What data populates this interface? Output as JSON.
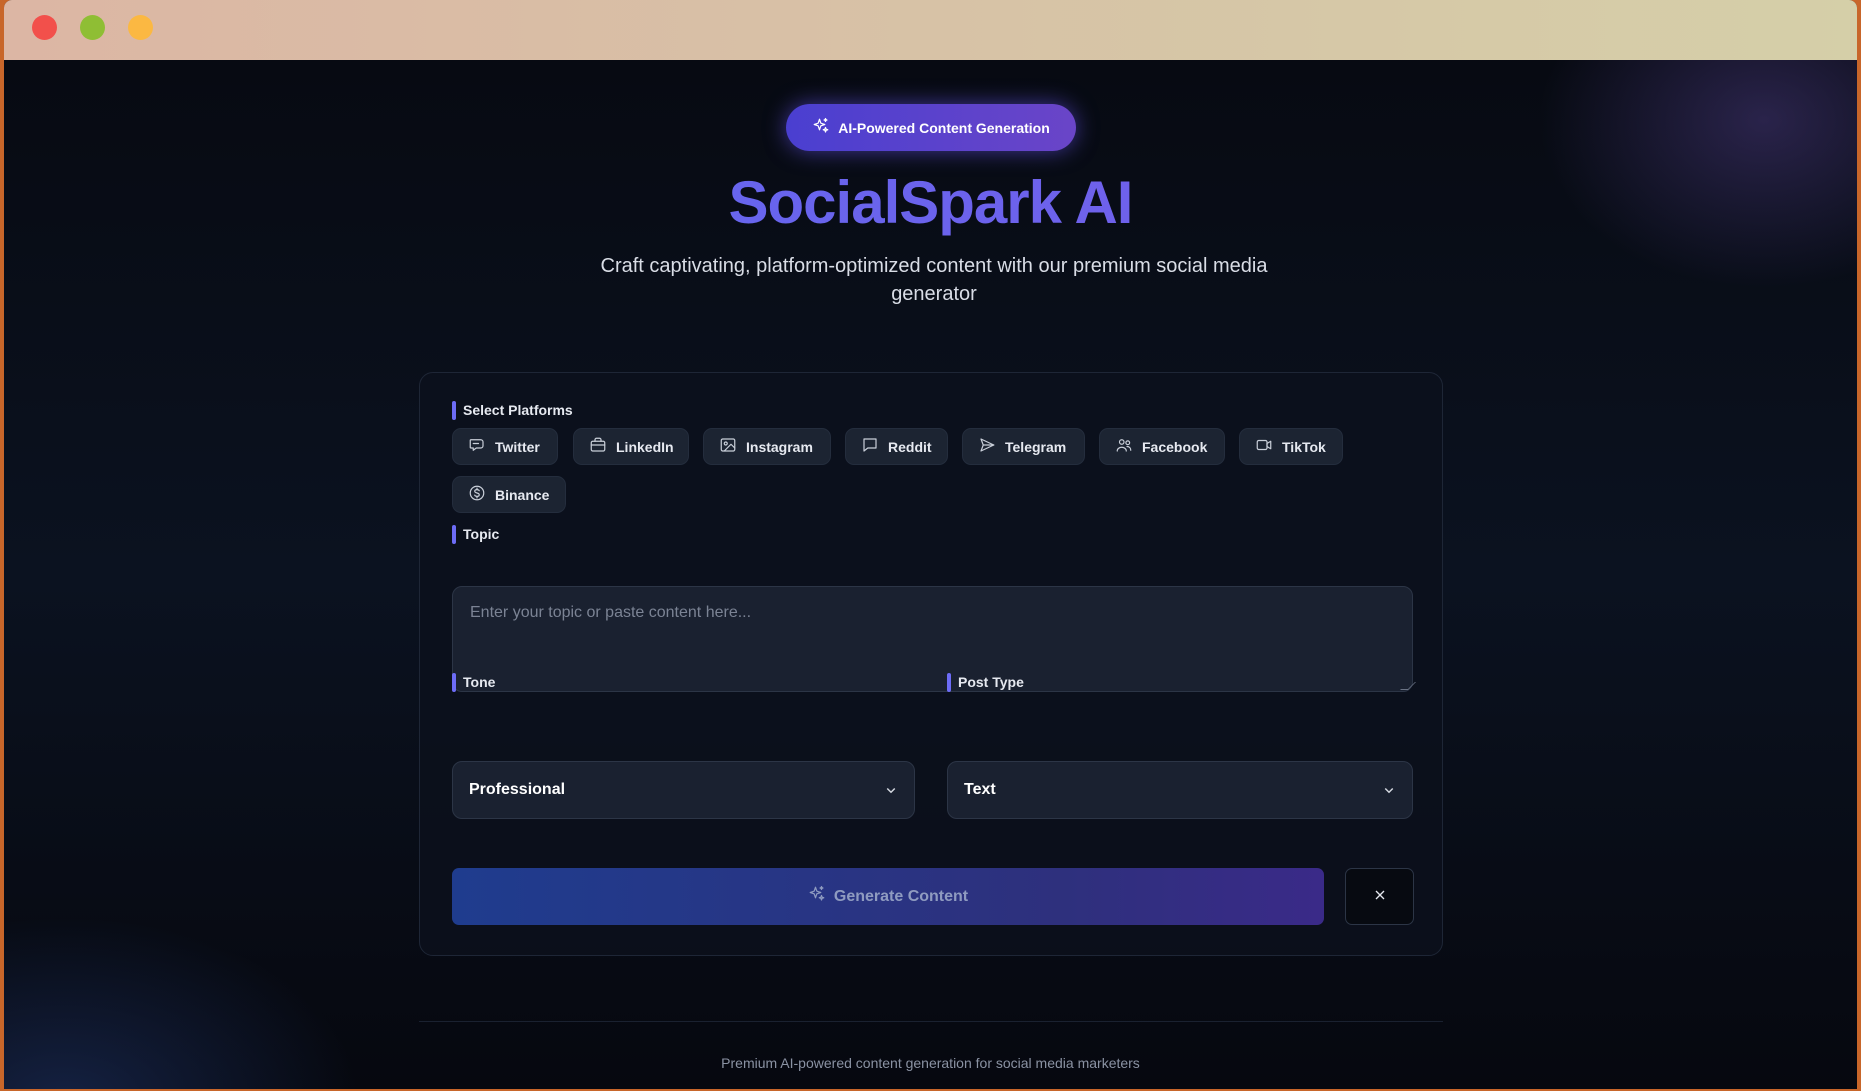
{
  "badge": {
    "label": "AI-Powered Content Generation",
    "icon": "sparkles-icon"
  },
  "hero": {
    "title": "SocialSpark AI",
    "subtitle": "Craft captivating, platform-optimized content with our premium social media generator"
  },
  "platforms": {
    "label": "Select Platforms",
    "items": [
      {
        "label": "Twitter",
        "icon": "chat-bubble-icon"
      },
      {
        "label": "LinkedIn",
        "icon": "briefcase-icon"
      },
      {
        "label": "Instagram",
        "icon": "image-icon"
      },
      {
        "label": "Reddit",
        "icon": "message-square-icon"
      },
      {
        "label": "Telegram",
        "icon": "send-icon"
      },
      {
        "label": "Facebook",
        "icon": "users-icon"
      },
      {
        "label": "TikTok",
        "icon": "video-icon"
      },
      {
        "label": "Binance",
        "icon": "dollar-circle-icon"
      }
    ]
  },
  "topic": {
    "label": "Topic",
    "value": "",
    "placeholder": "Enter your topic or paste content here..."
  },
  "tone": {
    "label": "Tone",
    "value": "Professional"
  },
  "post_type": {
    "label": "Post Type",
    "value": "Text"
  },
  "actions": {
    "generate_label": "Generate Content",
    "clear_icon": "close-icon"
  },
  "footer": {
    "text": "Premium AI-powered content generation for social media marketers"
  },
  "colors": {
    "accent": "#6d6cf6",
    "title_gradient_start": "#5b6cf2",
    "title_gradient_end": "#7b5ae6"
  }
}
